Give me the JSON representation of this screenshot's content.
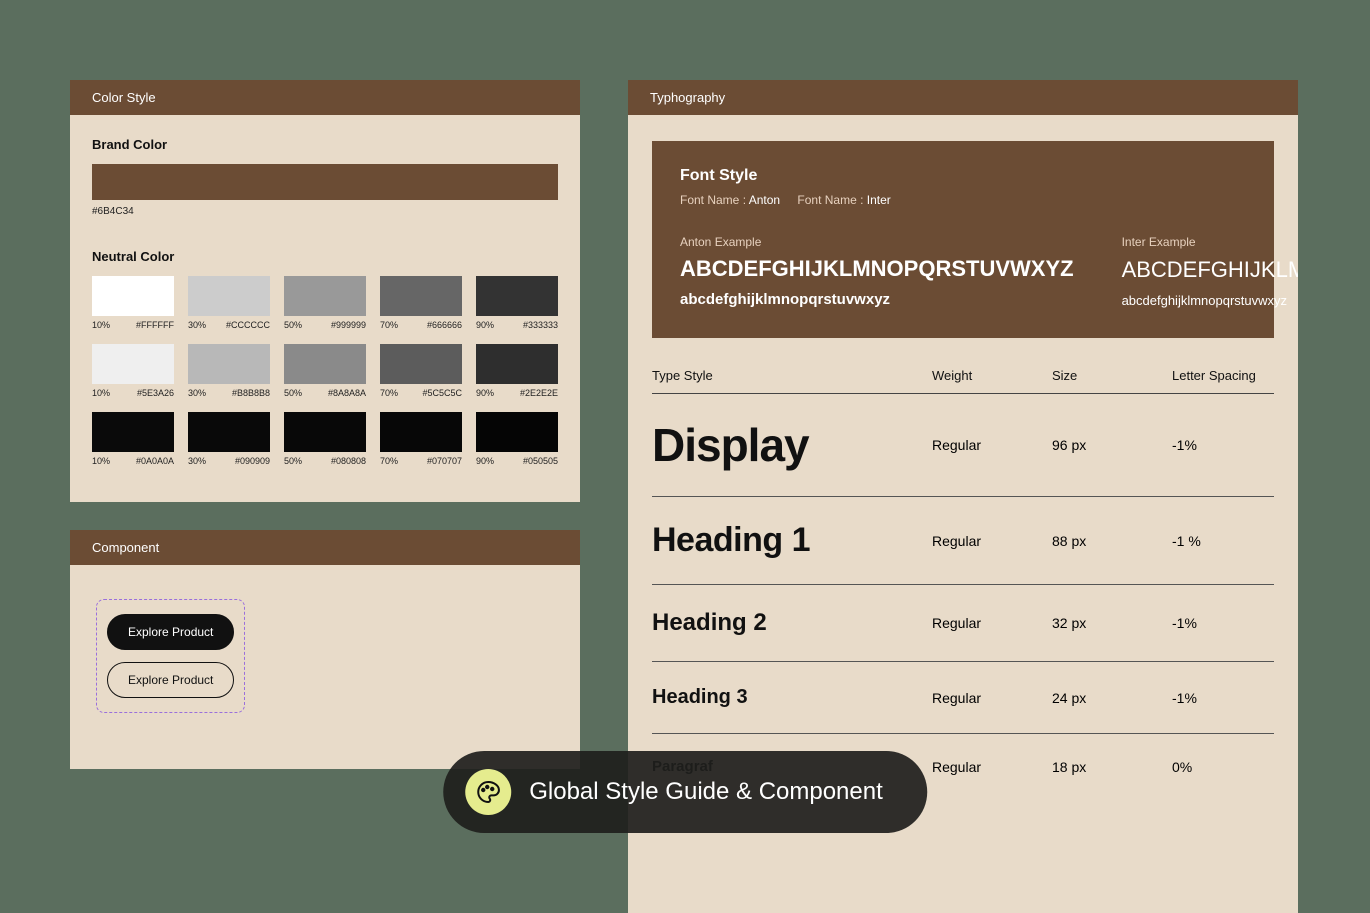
{
  "overlay": {
    "title": "Global Style Guide & Component"
  },
  "color_panel": {
    "title": "Color Style",
    "brand_label": "Brand Color",
    "brand_hex": "#6B4C34",
    "neutral_label": "Neutral Color",
    "rows": [
      [
        {
          "pct": "10%",
          "hex": "#FFFFFF",
          "c": "#FFFFFF"
        },
        {
          "pct": "30%",
          "hex": "#CCCCCC",
          "c": "#CCCCCC"
        },
        {
          "pct": "50%",
          "hex": "#999999",
          "c": "#999999"
        },
        {
          "pct": "70%",
          "hex": "#666666",
          "c": "#666666"
        },
        {
          "pct": "90%",
          "hex": "#333333",
          "c": "#333333"
        }
      ],
      [
        {
          "pct": "10%",
          "hex": "#5E3A26",
          "c": "#EFEFEF"
        },
        {
          "pct": "30%",
          "hex": "#B8B8B8",
          "c": "#B8B8B8"
        },
        {
          "pct": "50%",
          "hex": "#8A8A8A",
          "c": "#8A8A8A"
        },
        {
          "pct": "70%",
          "hex": "#5C5C5C",
          "c": "#5C5C5C"
        },
        {
          "pct": "90%",
          "hex": "#2E2E2E",
          "c": "#2E2E2E"
        }
      ],
      [
        {
          "pct": "10%",
          "hex": "#0A0A0A",
          "c": "#0A0A0A"
        },
        {
          "pct": "30%",
          "hex": "#090909",
          "c": "#090909"
        },
        {
          "pct": "50%",
          "hex": "#080808",
          "c": "#080808"
        },
        {
          "pct": "70%",
          "hex": "#070707",
          "c": "#070707"
        },
        {
          "pct": "90%",
          "hex": "#050505",
          "c": "#050505"
        }
      ]
    ]
  },
  "component_panel": {
    "title": "Component",
    "btn_solid": "Explore Product",
    "btn_ghost": "Explore Product"
  },
  "typo_panel": {
    "title": "Typhography",
    "font_style_label": "Font Style",
    "font_name_label": "Font Name :",
    "font1": "Anton",
    "font2": "Inter",
    "ex1_label": "Anton Example",
    "ex2_label": "Inter Example",
    "anton_upper": "ABCDEFGHIJKLMNOPQRSTUVWXYZ",
    "anton_lower": "abcdefghijklmnopqrstuvwxyz",
    "inter_upper": "ABCDEFGHIJKLMNOPQRSTUVWXYZ",
    "inter_lower": "abcdefghijklmnopqrstuvwxyz",
    "table_head": {
      "type": "Type Style",
      "weight": "Weight",
      "size": "Size",
      "spacing": "Letter Spacing"
    },
    "rows": [
      {
        "name": "Display",
        "cls": "s-display",
        "weight": "Regular",
        "size": "96 px",
        "spacing": "-1%"
      },
      {
        "name": "Heading 1",
        "cls": "s-h1",
        "weight": "Regular",
        "size": "88 px",
        "spacing": "-1 %"
      },
      {
        "name": "Heading 2",
        "cls": "s-h2",
        "weight": "Regular",
        "size": "32 px",
        "spacing": "-1%"
      },
      {
        "name": "Heading 3",
        "cls": "s-h3",
        "weight": "Regular",
        "size": "24 px",
        "spacing": "-1%"
      },
      {
        "name": "Paragraf",
        "cls": "s-p",
        "weight": "Regular",
        "size": "18 px",
        "spacing": "0%"
      }
    ]
  }
}
